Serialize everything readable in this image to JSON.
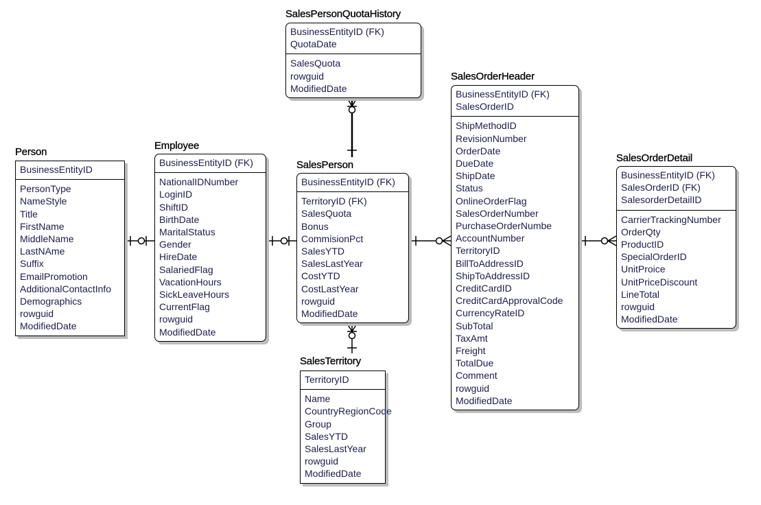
{
  "entities": {
    "person": {
      "name": "Person",
      "keys": [
        "BusinessEntityID"
      ],
      "attributes": [
        "PersonType",
        "NameStyle",
        "Title",
        "FirstName",
        "MiddleName",
        "LastNAme",
        "Suffix",
        "EmailPromotion",
        "AdditionalContactInfo",
        "Demographics",
        "rowguid",
        "ModifiedDate"
      ]
    },
    "employee": {
      "name": "Employee",
      "keys": [
        "BusinessEntityID (FK)"
      ],
      "attributes": [
        "NationalIDNumber",
        "LoginID",
        "ShiftID",
        "BirthDate",
        "MaritalStatus",
        "Gender",
        "HireDate",
        "SalariedFlag",
        "VacationHours",
        "SickLeaveHours",
        "CurrentFlag",
        "rowguid",
        "ModifiedDate"
      ]
    },
    "quota": {
      "name": "SalesPersonQuotaHistory",
      "keys": [
        "BusinessEntityID (FK)",
        "QuotaDate"
      ],
      "attributes": [
        "SalesQuota",
        "rowguid",
        "ModifiedDate"
      ]
    },
    "salesperson": {
      "name": "SalesPerson",
      "keys": [
        "BusinessEntityID (FK)"
      ],
      "attributes": [
        "TerritoryID (FK)",
        "SalesQuota",
        "Bonus",
        "CommisionPct",
        "SalesYTD",
        "SalesLastYear",
        "CostYTD",
        "CostLastYear",
        "rowguid",
        "ModifiedDate"
      ]
    },
    "territory": {
      "name": "SalesTerritory",
      "keys": [
        "TerritoryID"
      ],
      "attributes": [
        "Name",
        "CountryRegionCode",
        "Group",
        "SalesYTD",
        "SalesLastYear",
        "rowguid",
        "ModifiedDate"
      ]
    },
    "header": {
      "name": "SalesOrderHeader",
      "keys": [
        "BusinessEntityID (FK)",
        "SalesOrderID"
      ],
      "attributes": [
        "ShipMethodID",
        "RevisionNumber",
        "OrderDate",
        "DueDate",
        "ShipDate",
        "Status",
        "OnlineOrderFlag",
        "SalesOrderNumber",
        "PurchaseOrderNumbe",
        "AccountNumber",
        "TerritoryID",
        "BillToAddressID",
        "ShipToAddressID",
        "CreditCardID",
        "CreditCardApprovalCode",
        "CurrencyRateID",
        "SubTotal",
        "TaxAmt",
        "Freight",
        "TotalDue",
        "Comment",
        "rowguid",
        "ModifiedDate"
      ]
    },
    "detail": {
      "name": "SalesOrderDetail",
      "keys": [
        "BusinessEntityID (FK)",
        "SalesOrderID (FK)",
        "SalesorderDetailID"
      ],
      "attributes": [
        "CarrierTrackingNumber",
        "OrderQty",
        "ProductID",
        "SpecialOrderID",
        "UnitProice",
        "UnitPriceDiscount",
        "LineTotal",
        "rowguid",
        "ModifiedDate"
      ]
    }
  },
  "relationships": [
    {
      "from": "Person",
      "to": "Employee",
      "cardinality": "one to zero-or-one"
    },
    {
      "from": "Employee",
      "to": "SalesPerson",
      "cardinality": "one to zero-or-one"
    },
    {
      "from": "SalesPerson",
      "to": "SalesOrderHeader",
      "cardinality": "one to zero-or-many"
    },
    {
      "from": "SalesOrderHeader",
      "to": "SalesOrderDetail",
      "cardinality": "one to zero-or-many"
    },
    {
      "from": "SalesPerson",
      "to": "SalesPersonQuotaHistory",
      "cardinality": "one to zero-or-many"
    },
    {
      "from": "SalesTerritory",
      "to": "SalesPerson",
      "cardinality": "one to zero-or-many"
    }
  ]
}
